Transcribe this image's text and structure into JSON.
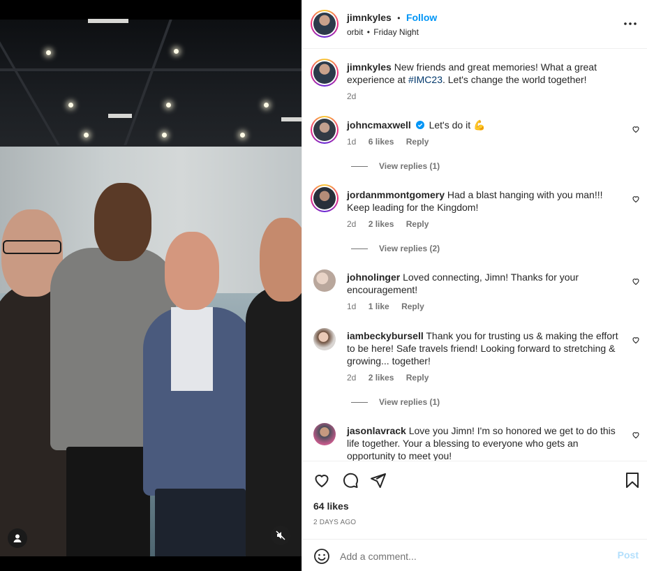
{
  "header": {
    "username": "jimnkyles",
    "separator": "•",
    "follow_label": "Follow",
    "location": "orbit",
    "location_sep": "•",
    "song": "Friday Night",
    "more_icon": "more-horizontal-icon"
  },
  "caption": {
    "username": "jimnkyles",
    "text_before": "New friends and great memories! What a great experience at ",
    "hashtag": "#IMC23",
    "text_after": ". Let's change the world together!",
    "age": "2d"
  },
  "comments": [
    {
      "username": "johncmaxwell",
      "verified": true,
      "text": "Let's do it 💪",
      "age": "1d",
      "likes": "6 likes",
      "reply": "Reply",
      "view_replies": "View replies (1)"
    },
    {
      "username": "jordanmmontgomery",
      "verified": false,
      "text": "Had a blast hanging with you man!!! Keep leading for the Kingdom!",
      "age": "2d",
      "likes": "2 likes",
      "reply": "Reply",
      "view_replies": "View replies (2)"
    },
    {
      "username": "johnolinger",
      "verified": false,
      "text": "Loved connecting, Jimn! Thanks for your encouragement!",
      "age": "1d",
      "likes": "1 like",
      "reply": "Reply",
      "view_replies": ""
    },
    {
      "username": "iambeckybursell",
      "verified": false,
      "text": "Thank you for trusting us & making the effort to be here! Safe travels friend! Looking forward to stretching & growing... together!",
      "age": "2d",
      "likes": "2 likes",
      "reply": "Reply",
      "view_replies": "View replies (1)"
    },
    {
      "username": "jasonlavrack",
      "verified": false,
      "text": "Love you Jimn! I'm so honored we get to do this life together. Your a blessing to everyone who gets an opportunity to meet you!",
      "age": "",
      "likes": "",
      "reply": "",
      "view_replies": ""
    }
  ],
  "actions": {
    "likes": "64 likes",
    "date": "2 DAYS AGO"
  },
  "add_comment": {
    "placeholder": "Add a comment...",
    "post_label": "Post"
  },
  "colors": {
    "link_blue": "#0095f6",
    "hashtag_blue": "#00376b",
    "secondary_text": "#737373",
    "post_disabled": "#b2dffc"
  }
}
